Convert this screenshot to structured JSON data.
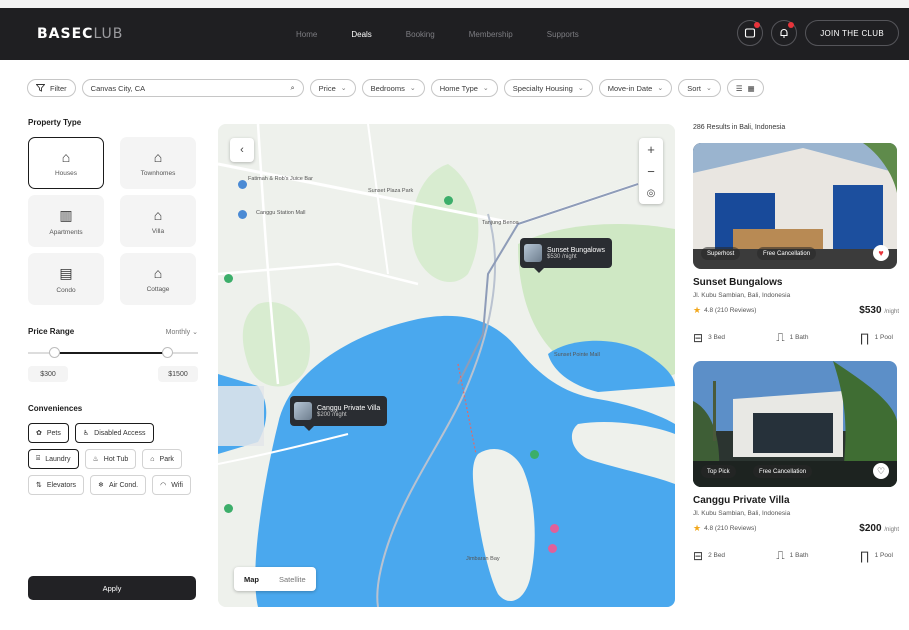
{
  "header": {
    "logo_bold": "BASEC",
    "logo_light": "LUB",
    "nav": [
      "Home",
      "Deals",
      "Booking",
      "Membership",
      "Supports"
    ],
    "active_nav": "Deals",
    "join_label": "JOIN THE CLUB"
  },
  "filters": {
    "filter_label": "Filter",
    "search_value": "Canvas City, CA",
    "chips": [
      "Price",
      "Bedrooms",
      "Home Type",
      "Specialty Housing",
      "Move-in Date",
      "Sort"
    ]
  },
  "sidebar": {
    "property_title": "Property Type",
    "property_types": [
      {
        "label": "Houses",
        "icon": "house-icon",
        "glyph": "⌂",
        "selected": true
      },
      {
        "label": "Townhomes",
        "icon": "townhome-icon",
        "glyph": "⌂",
        "selected": false
      },
      {
        "label": "Apartments",
        "icon": "apartment-icon",
        "glyph": "▥",
        "selected": false
      },
      {
        "label": "Villa",
        "icon": "villa-icon",
        "glyph": "⌂",
        "selected": false
      },
      {
        "label": "Condo",
        "icon": "condo-icon",
        "glyph": "▤",
        "selected": false
      },
      {
        "label": "Cottage",
        "icon": "cottage-icon",
        "glyph": "⌂",
        "selected": false
      }
    ],
    "price_title": "Price Range",
    "price_mode": "Monthly",
    "price_min": "$300",
    "price_max": "$1500",
    "price_range": {
      "min_fraction": 0.15,
      "max_fraction": 0.82
    },
    "amenities_title": "Conveniences",
    "amenities": [
      {
        "label": "Pets",
        "icon": "paw-icon",
        "glyph": "✿",
        "selected": true
      },
      {
        "label": "Disabled Access",
        "icon": "accessible-icon",
        "glyph": "♿",
        "selected": true
      },
      {
        "label": "Laundry",
        "icon": "laundry-icon",
        "glyph": "⌸",
        "selected": true
      },
      {
        "label": "Hot Tub",
        "icon": "hottub-icon",
        "glyph": "♨",
        "selected": false
      },
      {
        "label": "Park",
        "icon": "park-icon",
        "glyph": "⌂",
        "selected": false
      },
      {
        "label": "Elevators",
        "icon": "elevator-icon",
        "glyph": "⇅",
        "selected": false
      },
      {
        "label": "Air Cond.",
        "icon": "ac-icon",
        "glyph": "❄",
        "selected": false
      },
      {
        "label": "Wifi",
        "icon": "wifi-icon",
        "glyph": "◠",
        "selected": false
      }
    ],
    "apply_label": "Apply"
  },
  "map": {
    "toggle": [
      "Map",
      "Satellite"
    ],
    "active_toggle": "Map",
    "labels": [
      "Fatimah & Rob's Juice Bar",
      "Canggu Station Mall",
      "Sunset Plaza Park",
      "Tanjung Benoa",
      "Sunset Pointe Mall",
      "Jimbaran Bay"
    ],
    "markers": [
      {
        "name": "Sunset Bungalows",
        "sub": "$530 /night"
      },
      {
        "name": "Canggu Private Villa",
        "sub": "$200 /night"
      }
    ]
  },
  "listings": {
    "count_text": "286 Results in Bali, Indonesia",
    "items": [
      {
        "tags": [
          "Superhost",
          "Free Cancellation"
        ],
        "name": "Sunset Bungalows",
        "location": "Jl. Kubu Sambian, Bali, Indonesia",
        "rating": "4.8 (210 Reviews)",
        "price": "$530",
        "price_unit": "/night",
        "specs": [
          "3 Bed",
          "1 Bath",
          "1 Pool"
        ],
        "favorited": true
      },
      {
        "tags": [
          "Top Pick",
          "Free Cancellation"
        ],
        "name": "Canggu Private Villa",
        "location": "Jl. Kubu Sambian, Bali, Indonesia",
        "rating": "4.8 (210 Reviews)",
        "price": "$200",
        "price_unit": "/night",
        "specs": [
          "2 Bed",
          "1 Bath",
          "1 Pool"
        ],
        "favorited": false
      }
    ]
  },
  "colors": {
    "header_bg": "#1f1f22",
    "water": "#4aa8ee",
    "land": "#eef1ec",
    "green": "#cfe8c4",
    "accent_red": "#e8343b",
    "star": "#f2a71b"
  }
}
